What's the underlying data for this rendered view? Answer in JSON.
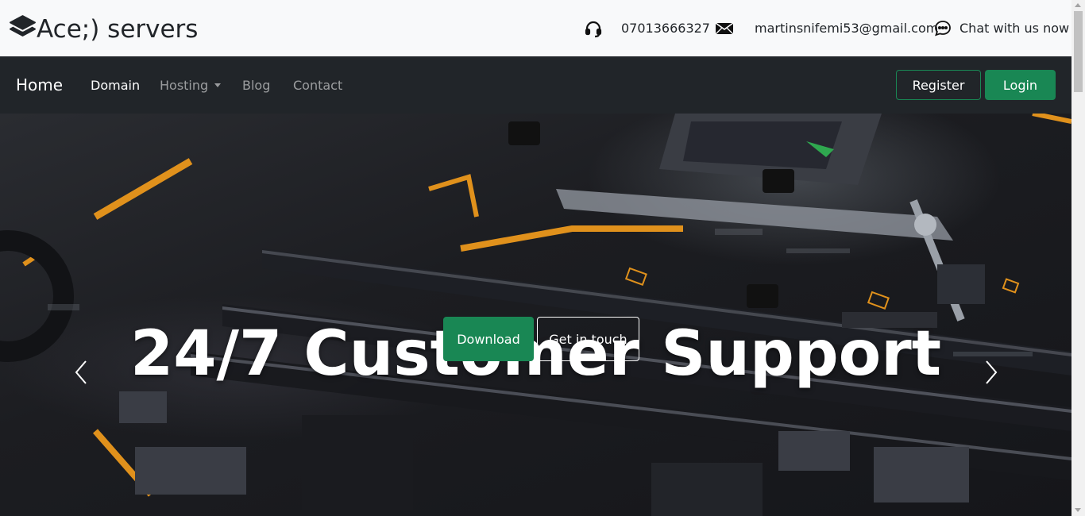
{
  "brand": {
    "name": "Ace;) servers",
    "icon": "layers-icon"
  },
  "contact": {
    "phone": "07013666327",
    "email": "martinsnifemi53@gmail.com",
    "chat": "Chat with us now",
    "icons": [
      "headset-icon",
      "envelope-icon",
      "chat-dots-icon"
    ]
  },
  "navbar": {
    "brand": "Home",
    "links": [
      {
        "label": "Domain",
        "active": true
      },
      {
        "label": "Hosting",
        "dropdown": true
      },
      {
        "label": "Blog"
      },
      {
        "label": "Contact"
      }
    ],
    "register": "Register",
    "login": "Login"
  },
  "hero": {
    "title": "24/7 Customer Support",
    "primary_button": "Download",
    "secondary_button": "Get in touch"
  },
  "colors": {
    "accent": "#198754",
    "navbar_bg": "#212529",
    "topbar_bg": "#f8f9fa"
  }
}
